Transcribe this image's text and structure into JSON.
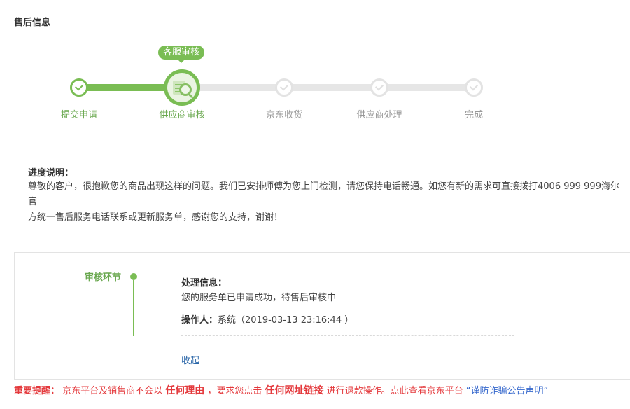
{
  "section_title": "售后信息",
  "stepper": {
    "current_bubble": "客服审核",
    "steps": [
      {
        "label": "提交申请",
        "state": "done"
      },
      {
        "label": "供应商审核",
        "state": "current"
      },
      {
        "label": "京东收货",
        "state": "todo"
      },
      {
        "label": "供应商处理",
        "state": "todo"
      },
      {
        "label": "完成",
        "state": "todo"
      }
    ],
    "colors": {
      "active": "#7abd54",
      "inactive": "#e6e6e6"
    }
  },
  "progress": {
    "title": "进度说明：",
    "line1": "尊敬的客户，很抱歉您的商品出现这样的问题。我们已安排师傅为您上门检测，请您保持电话畅通。如您有新的需求可直接拨打4006 999 999海尔官",
    "line2": "方统一售后服务电话联系或更新服务单，感谢您的支持，谢谢！"
  },
  "log": {
    "stage_label": "审核环节",
    "info_title": "处理信息：",
    "info_text": "您的服务单已申请成功，待售后审核中",
    "operator_label": "操作人：",
    "operator_value": "系统（2019-03-13 23:16:44 ）",
    "collapse_label": "收起"
  },
  "warning": {
    "prefix": "重要提醒：",
    "part1": " 京东平台及销售商不会以 ",
    "reason": "任何理由",
    "part2": " ，要求您点击 ",
    "link_words": "任何网址链接",
    "part3": " 进行退款操作。点此查看京东平台 ",
    "notice_link": "“谨防诈骗公告声明”"
  }
}
